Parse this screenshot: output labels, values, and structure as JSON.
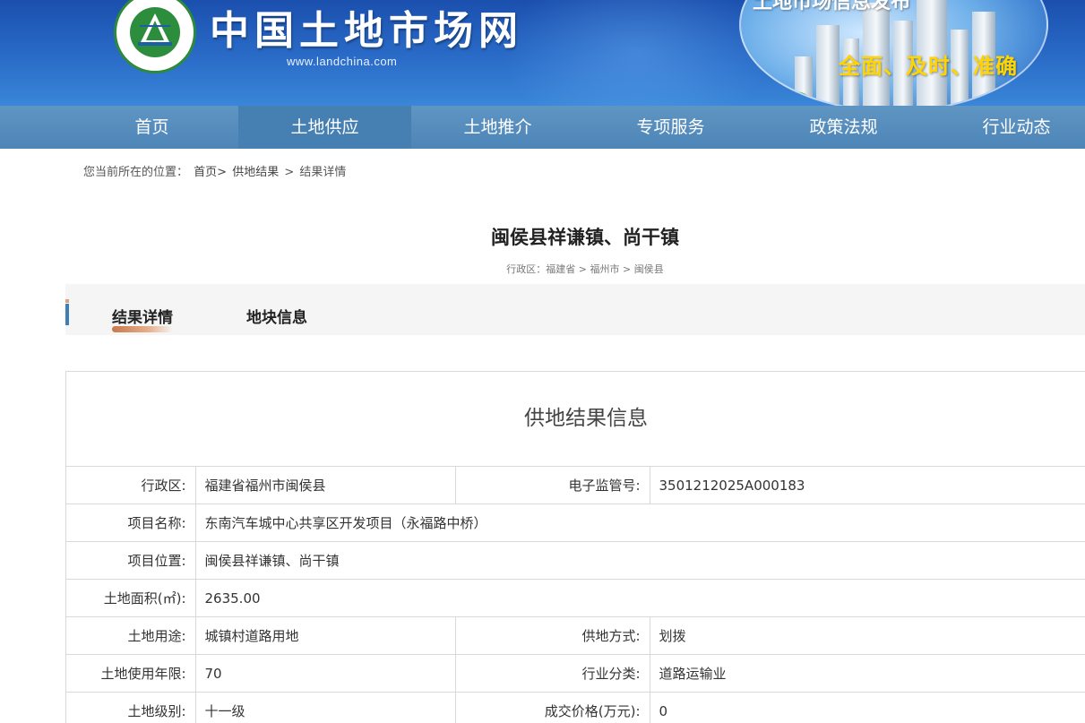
{
  "header": {
    "site_title": "中国土地市场网",
    "site_url": "www.landchina.com",
    "slogan": "全面、及时、准确",
    "slogan_top": "土地市场信息发布",
    "logo_ring_text": "中国土地市场网 WWW.LANDCHINA.COM"
  },
  "nav": {
    "items": [
      {
        "label": "首页"
      },
      {
        "label": "土地供应"
      },
      {
        "label": "土地推介"
      },
      {
        "label": "专项服务"
      },
      {
        "label": "政策法规"
      },
      {
        "label": "行业动态"
      }
    ],
    "active_index": 1
  },
  "breadcrumb": {
    "prefix": "您当前所在的位置：",
    "items": [
      "首页>",
      "供地结果",
      ">",
      "结果详情"
    ]
  },
  "page": {
    "title": "闽侯县祥谦镇、尚干镇",
    "region_label": "行政区：福建省 > 福州市 > 闽侯县"
  },
  "tabs": [
    {
      "label": "结果详情",
      "active": true
    },
    {
      "label": "地块信息",
      "active": false
    }
  ],
  "result": {
    "heading": "供地结果信息",
    "rows": [
      {
        "k1": "行政区:",
        "v1": "福建省福州市闽侯县",
        "k2": "电子监管号:",
        "v2": "3501212025A000183"
      },
      {
        "k1": "项目名称:",
        "full": "东南汽车城中心共享区开发项目（永福路中桥）"
      },
      {
        "k1": "项目位置:",
        "full": "闽侯县祥谦镇、尚干镇"
      },
      {
        "k1": "土地面积(㎡):",
        "full": "2635.00"
      },
      {
        "k1": "土地用途:",
        "v1": "城镇村道路用地",
        "k2": "供地方式:",
        "v2": "划拨"
      },
      {
        "k1": "土地使用年限:",
        "v1": "70",
        "k2": "行业分类:",
        "v2": "道路运输业"
      },
      {
        "k1": "土地级别:",
        "v1": "十一级",
        "k2": "成交价格(万元):",
        "v2": "0"
      }
    ]
  },
  "colors": {
    "banner": "#2a6cc8",
    "nav": "#5a91c0",
    "nav_active": "#467fb2",
    "slogan": "#ffd400",
    "tab_marker": "#3e7fb8",
    "tab_underline": "#c8784a"
  }
}
